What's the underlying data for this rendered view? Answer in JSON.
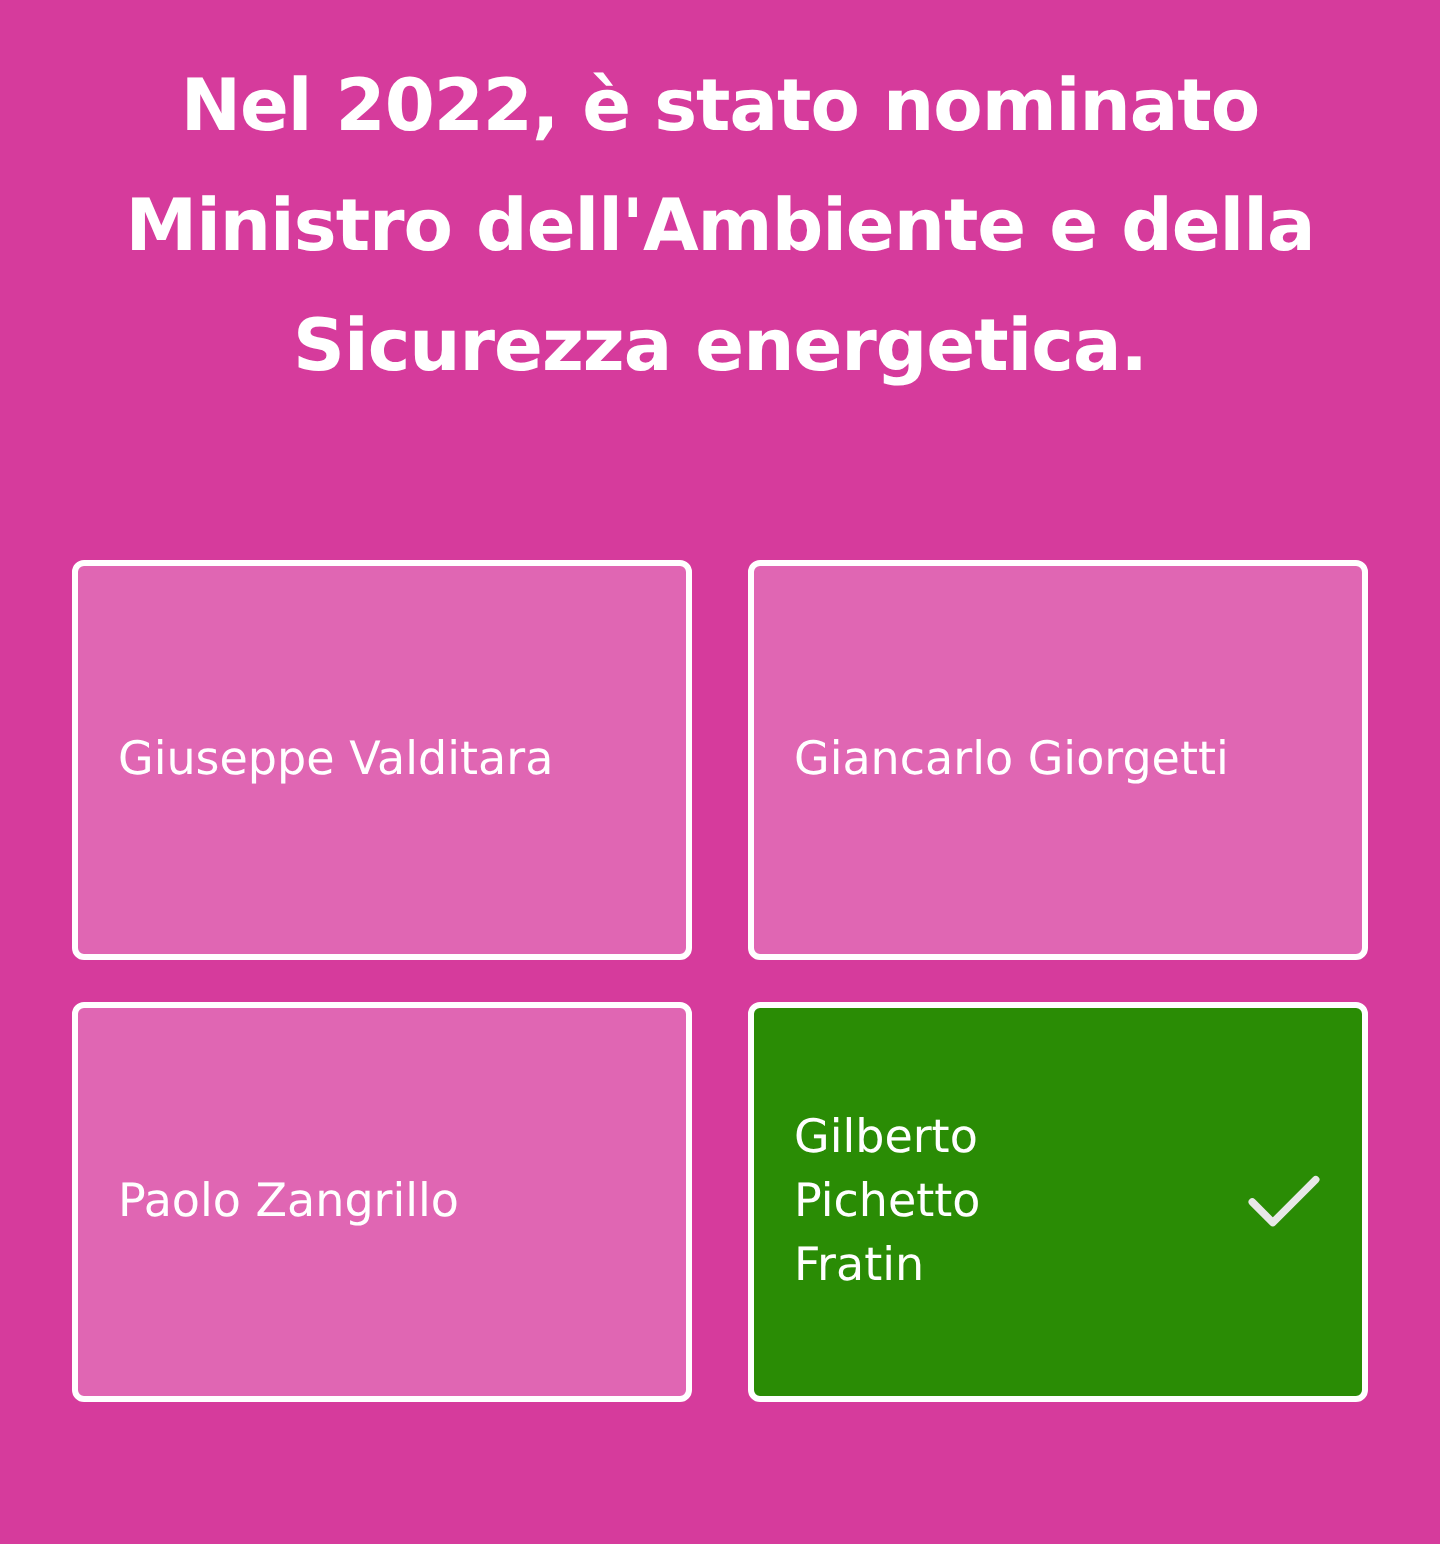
{
  "question": "Nel 2022, è stato nominato Ministro dell'Ambiente e della Sicurezza energetica.",
  "answer_rows": [
    {
      "answers": [
        {
          "text": "Giuseppe Valditara",
          "correct": false
        },
        {
          "text": "Giancarlo Giorgetti",
          "correct": false
        }
      ]
    },
    {
      "answers": [
        {
          "text": "Paolo Zangrillo",
          "correct": false
        },
        {
          "text": "Gilberto Pichetto Fratin",
          "correct": true
        }
      ]
    }
  ]
}
